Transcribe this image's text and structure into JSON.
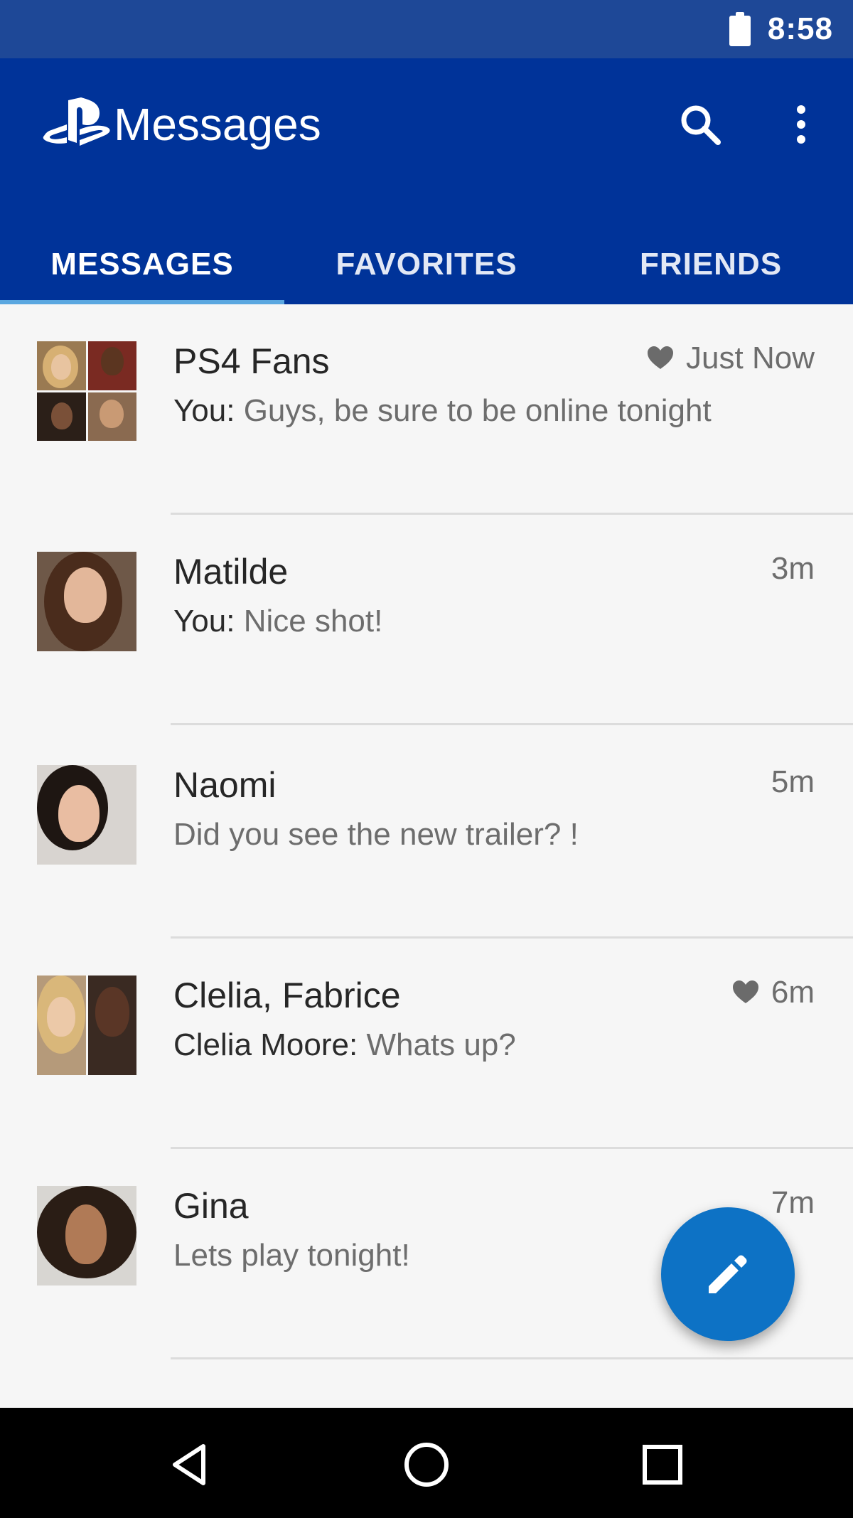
{
  "status_bar": {
    "time": "8:58",
    "icons": [
      "battery-icon"
    ]
  },
  "app_bar": {
    "logo": "playstation-logo-icon",
    "title": "Messages",
    "actions": [
      "search-icon",
      "overflow-menu-icon"
    ]
  },
  "tabs": [
    {
      "label": "MESSAGES",
      "selected": true
    },
    {
      "label": "FAVORITES",
      "selected": false
    },
    {
      "label": "FRIENDS",
      "selected": false
    }
  ],
  "messages": [
    {
      "name": "PS4 Fans",
      "sender": "You",
      "separator": ":",
      "text": " Guys, be sure to be online tonight",
      "time": "Just Now",
      "favorite": true
    },
    {
      "name": "Matilde",
      "sender": "You",
      "separator": ":",
      "text": " Nice shot!",
      "time": "3m",
      "favorite": false
    },
    {
      "name": "Naomi",
      "text": "Did you see the new trailer? !",
      "time": "5m",
      "favorite": false
    },
    {
      "name": "Clelia, Fabrice",
      "sender": "Clelia Moore",
      "separator": ":",
      "text": " Whats up?",
      "time": "6m",
      "favorite": true
    },
    {
      "name": "Gina",
      "text": "Lets play tonight!",
      "time": "7m",
      "favorite": false
    }
  ],
  "fab": {
    "icon": "pencil-icon"
  },
  "nav_bar": {
    "icons": [
      "back-icon",
      "home-icon",
      "recents-icon"
    ]
  },
  "colors": {
    "status_bar": "#1e4897",
    "app_bar": "#003399",
    "tab_indicator": "#5aa7e0",
    "fab": "#0d72c5"
  }
}
